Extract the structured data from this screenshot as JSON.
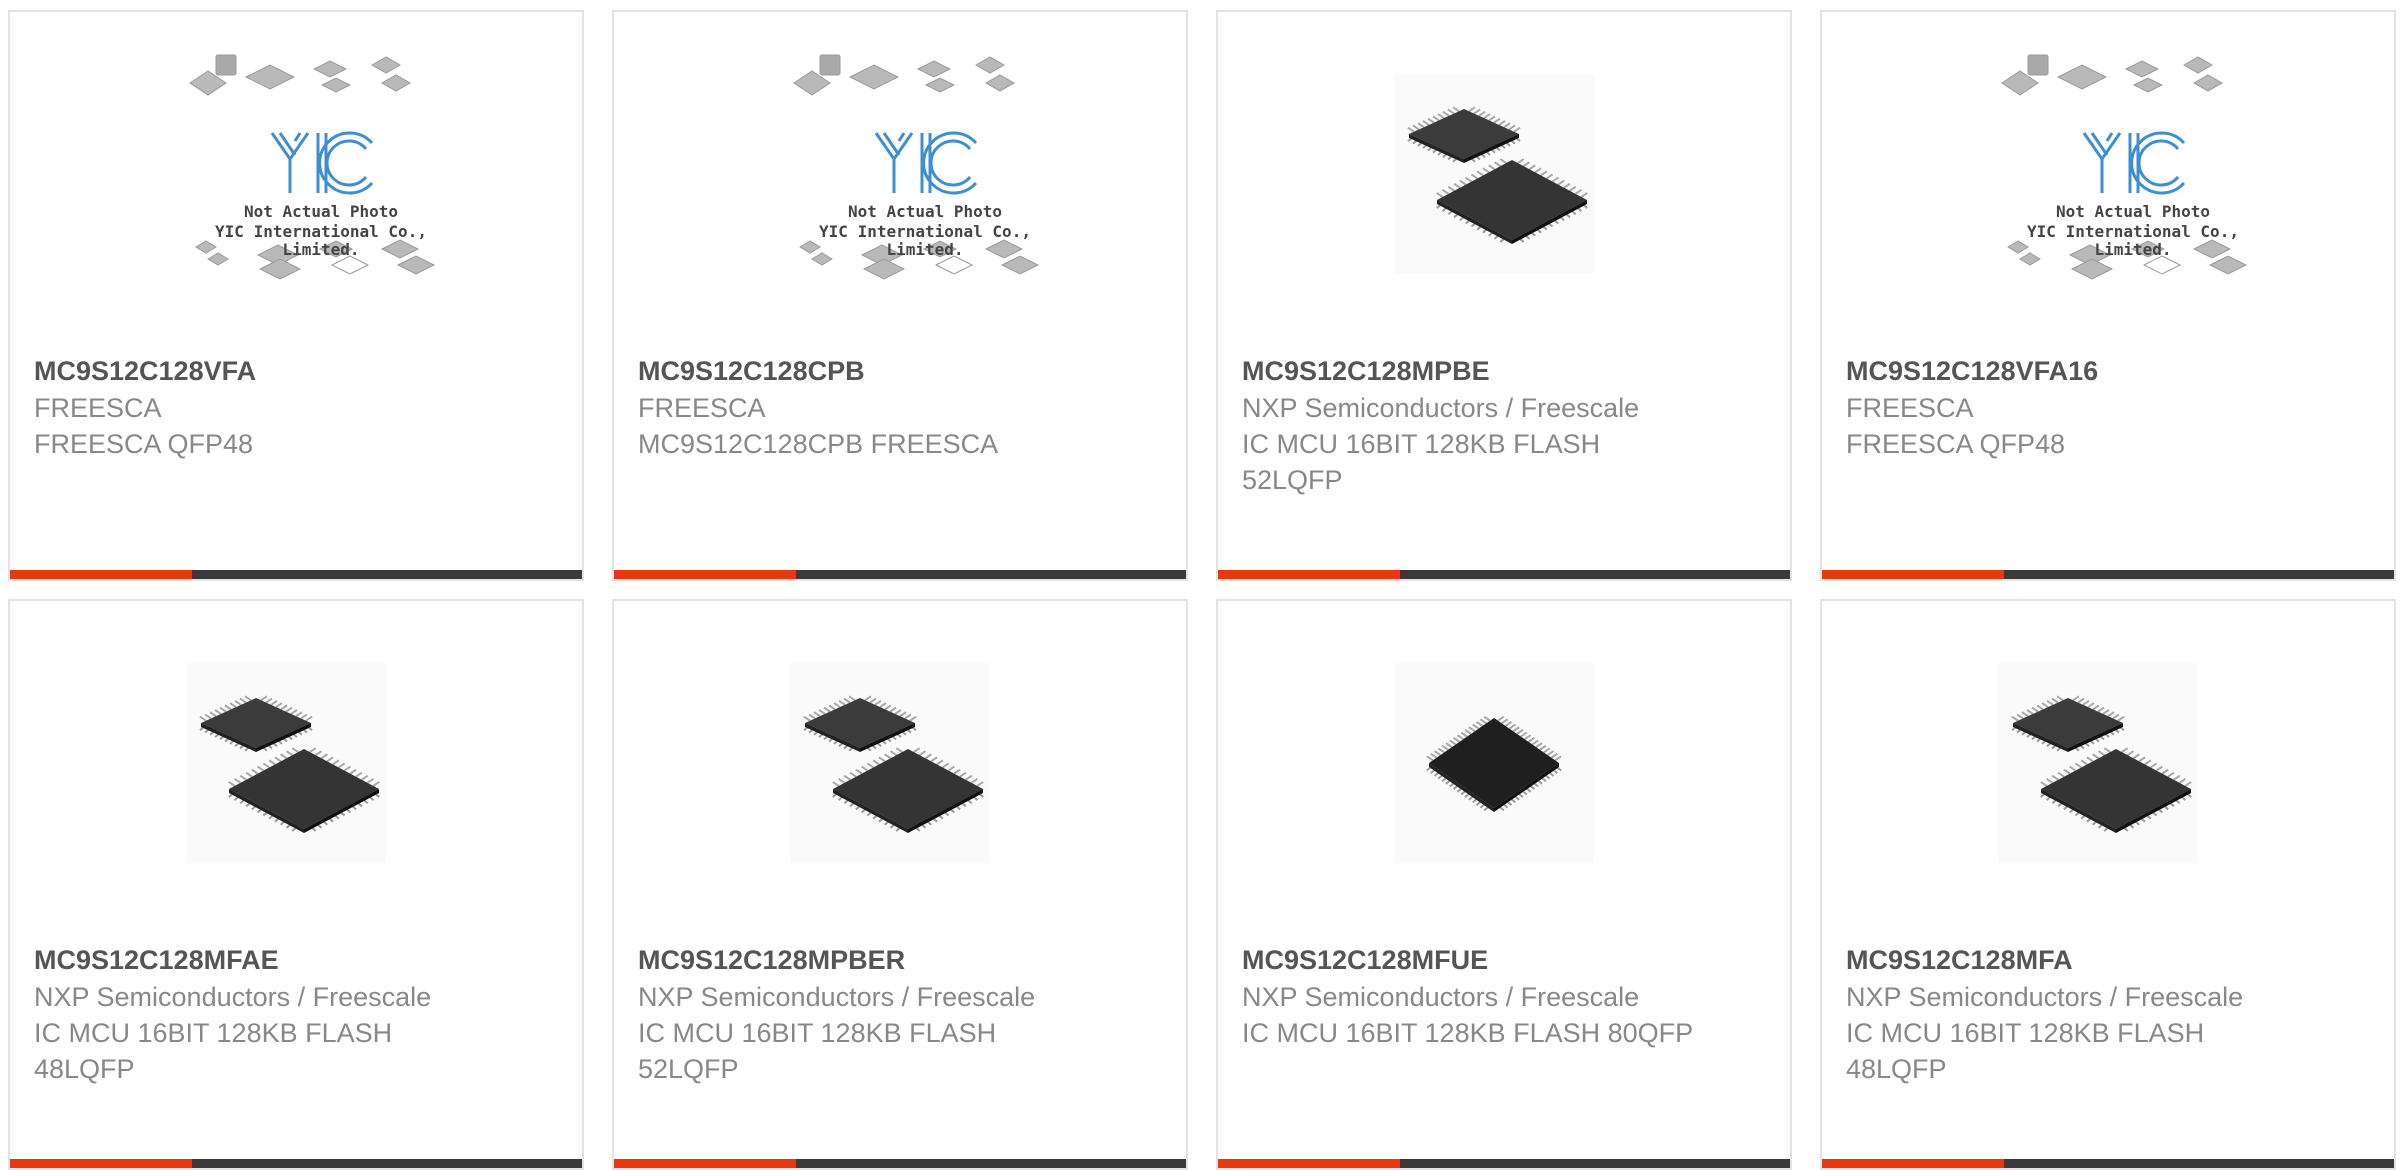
{
  "placeholder": {
    "line1": "Not Actual Photo",
    "line2": "YIC International Co., Limited.",
    "logo_text": "YIC"
  },
  "colors": {
    "accent": "#e8380d",
    "bar": "#3a3a3a",
    "title": "#555555",
    "text": "#888888",
    "border": "#e3e3e3"
  },
  "products": [
    {
      "part": "MC9S12C128VFA",
      "manufacturer": "FREESCA",
      "description": "FREESCA QFP48",
      "image": "placeholder-logo"
    },
    {
      "part": "MC9S12C128CPB",
      "manufacturer": "FREESCA",
      "description": "MC9S12C128CPB FREESCA",
      "image": "placeholder-logo"
    },
    {
      "part": "MC9S12C128MPBE",
      "manufacturer": "NXP Semiconductors / Freescale",
      "description": "IC MCU 16BIT 128KB FLASH 52LQFP",
      "image": "lqfp-chips"
    },
    {
      "part": "MC9S12C128VFA16",
      "manufacturer": "FREESCA",
      "description": "FREESCA QFP48",
      "image": "placeholder-logo"
    },
    {
      "part": "MC9S12C128MFAE",
      "manufacturer": "NXP Semiconductors / Freescale",
      "description": "IC MCU 16BIT 128KB FLASH 48LQFP",
      "image": "lqfp-chips"
    },
    {
      "part": "MC9S12C128MPBER",
      "manufacturer": "NXP Semiconductors / Freescale",
      "description": "IC MCU 16BIT 128KB FLASH 52LQFP",
      "image": "lqfp-chips"
    },
    {
      "part": "MC9S12C128MFUE",
      "manufacturer": "NXP Semiconductors / Freescale",
      "description": "IC MCU 16BIT 128KB FLASH 80QFP",
      "image": "qfp-chip"
    },
    {
      "part": "MC9S12C128MFA",
      "manufacturer": "NXP Semiconductors / Freescale",
      "description": "IC MCU 16BIT 128KB FLASH 48LQFP",
      "image": "lqfp-chips"
    }
  ]
}
